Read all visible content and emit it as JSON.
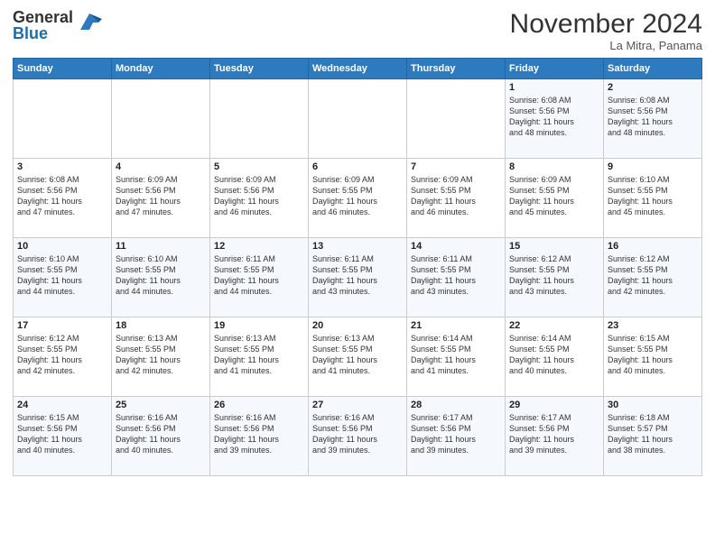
{
  "header": {
    "logo_general": "General",
    "logo_blue": "Blue",
    "month_title": "November 2024",
    "location": "La Mitra, Panama"
  },
  "days_of_week": [
    "Sunday",
    "Monday",
    "Tuesday",
    "Wednesday",
    "Thursday",
    "Friday",
    "Saturday"
  ],
  "weeks": [
    [
      {
        "day": "",
        "info": ""
      },
      {
        "day": "",
        "info": ""
      },
      {
        "day": "",
        "info": ""
      },
      {
        "day": "",
        "info": ""
      },
      {
        "day": "",
        "info": ""
      },
      {
        "day": "1",
        "info": "Sunrise: 6:08 AM\nSunset: 5:56 PM\nDaylight: 11 hours\nand 48 minutes."
      },
      {
        "day": "2",
        "info": "Sunrise: 6:08 AM\nSunset: 5:56 PM\nDaylight: 11 hours\nand 48 minutes."
      }
    ],
    [
      {
        "day": "3",
        "info": "Sunrise: 6:08 AM\nSunset: 5:56 PM\nDaylight: 11 hours\nand 47 minutes."
      },
      {
        "day": "4",
        "info": "Sunrise: 6:09 AM\nSunset: 5:56 PM\nDaylight: 11 hours\nand 47 minutes."
      },
      {
        "day": "5",
        "info": "Sunrise: 6:09 AM\nSunset: 5:56 PM\nDaylight: 11 hours\nand 46 minutes."
      },
      {
        "day": "6",
        "info": "Sunrise: 6:09 AM\nSunset: 5:55 PM\nDaylight: 11 hours\nand 46 minutes."
      },
      {
        "day": "7",
        "info": "Sunrise: 6:09 AM\nSunset: 5:55 PM\nDaylight: 11 hours\nand 46 minutes."
      },
      {
        "day": "8",
        "info": "Sunrise: 6:09 AM\nSunset: 5:55 PM\nDaylight: 11 hours\nand 45 minutes."
      },
      {
        "day": "9",
        "info": "Sunrise: 6:10 AM\nSunset: 5:55 PM\nDaylight: 11 hours\nand 45 minutes."
      }
    ],
    [
      {
        "day": "10",
        "info": "Sunrise: 6:10 AM\nSunset: 5:55 PM\nDaylight: 11 hours\nand 44 minutes."
      },
      {
        "day": "11",
        "info": "Sunrise: 6:10 AM\nSunset: 5:55 PM\nDaylight: 11 hours\nand 44 minutes."
      },
      {
        "day": "12",
        "info": "Sunrise: 6:11 AM\nSunset: 5:55 PM\nDaylight: 11 hours\nand 44 minutes."
      },
      {
        "day": "13",
        "info": "Sunrise: 6:11 AM\nSunset: 5:55 PM\nDaylight: 11 hours\nand 43 minutes."
      },
      {
        "day": "14",
        "info": "Sunrise: 6:11 AM\nSunset: 5:55 PM\nDaylight: 11 hours\nand 43 minutes."
      },
      {
        "day": "15",
        "info": "Sunrise: 6:12 AM\nSunset: 5:55 PM\nDaylight: 11 hours\nand 43 minutes."
      },
      {
        "day": "16",
        "info": "Sunrise: 6:12 AM\nSunset: 5:55 PM\nDaylight: 11 hours\nand 42 minutes."
      }
    ],
    [
      {
        "day": "17",
        "info": "Sunrise: 6:12 AM\nSunset: 5:55 PM\nDaylight: 11 hours\nand 42 minutes."
      },
      {
        "day": "18",
        "info": "Sunrise: 6:13 AM\nSunset: 5:55 PM\nDaylight: 11 hours\nand 42 minutes."
      },
      {
        "day": "19",
        "info": "Sunrise: 6:13 AM\nSunset: 5:55 PM\nDaylight: 11 hours\nand 41 minutes."
      },
      {
        "day": "20",
        "info": "Sunrise: 6:13 AM\nSunset: 5:55 PM\nDaylight: 11 hours\nand 41 minutes."
      },
      {
        "day": "21",
        "info": "Sunrise: 6:14 AM\nSunset: 5:55 PM\nDaylight: 11 hours\nand 41 minutes."
      },
      {
        "day": "22",
        "info": "Sunrise: 6:14 AM\nSunset: 5:55 PM\nDaylight: 11 hours\nand 40 minutes."
      },
      {
        "day": "23",
        "info": "Sunrise: 6:15 AM\nSunset: 5:55 PM\nDaylight: 11 hours\nand 40 minutes."
      }
    ],
    [
      {
        "day": "24",
        "info": "Sunrise: 6:15 AM\nSunset: 5:56 PM\nDaylight: 11 hours\nand 40 minutes."
      },
      {
        "day": "25",
        "info": "Sunrise: 6:16 AM\nSunset: 5:56 PM\nDaylight: 11 hours\nand 40 minutes."
      },
      {
        "day": "26",
        "info": "Sunrise: 6:16 AM\nSunset: 5:56 PM\nDaylight: 11 hours\nand 39 minutes."
      },
      {
        "day": "27",
        "info": "Sunrise: 6:16 AM\nSunset: 5:56 PM\nDaylight: 11 hours\nand 39 minutes."
      },
      {
        "day": "28",
        "info": "Sunrise: 6:17 AM\nSunset: 5:56 PM\nDaylight: 11 hours\nand 39 minutes."
      },
      {
        "day": "29",
        "info": "Sunrise: 6:17 AM\nSunset: 5:56 PM\nDaylight: 11 hours\nand 39 minutes."
      },
      {
        "day": "30",
        "info": "Sunrise: 6:18 AM\nSunset: 5:57 PM\nDaylight: 11 hours\nand 38 minutes."
      }
    ]
  ]
}
